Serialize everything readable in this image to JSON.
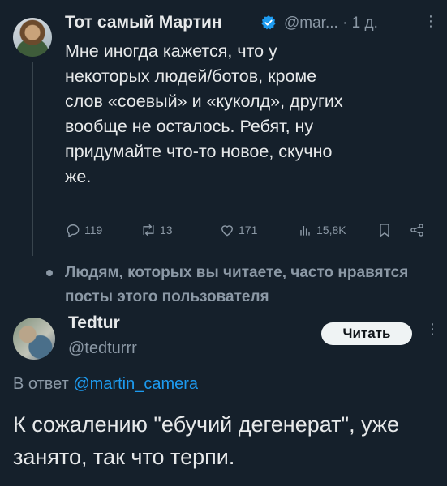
{
  "tweet": {
    "author_name": "Тот самый Мартин",
    "author_handle": "@mar...",
    "time": "· 1 д.",
    "more": "⋮",
    "text": "Мне иногда кажется, что у\nнекоторых людей/ботов, кроме\nслов «соевый» и «куколд», других\nвообще не осталось. Ребят, ну\nпридумайте что-то новое, скучно\nже.",
    "actions": {
      "replies": "119",
      "retweets": "13",
      "likes": "171",
      "views": "15,8K"
    }
  },
  "social_context": "Людям, которых вы читаете, часто нравятся посты этого пользователя",
  "reply": {
    "author_name": "Tedtur",
    "author_handle": "@tedturrr",
    "follow_label": "Читать",
    "more": "⋮",
    "reply_to_prefix": "В ответ",
    "reply_to_handle": "@martin_camera",
    "text": "К сожалению \"ебучий дегенерат\", уже занято, так что терпи."
  },
  "colors": {
    "background": "#15202b",
    "text": "#e7e9ea",
    "secondary": "#8b98a5",
    "accent": "#1d9bf0"
  }
}
